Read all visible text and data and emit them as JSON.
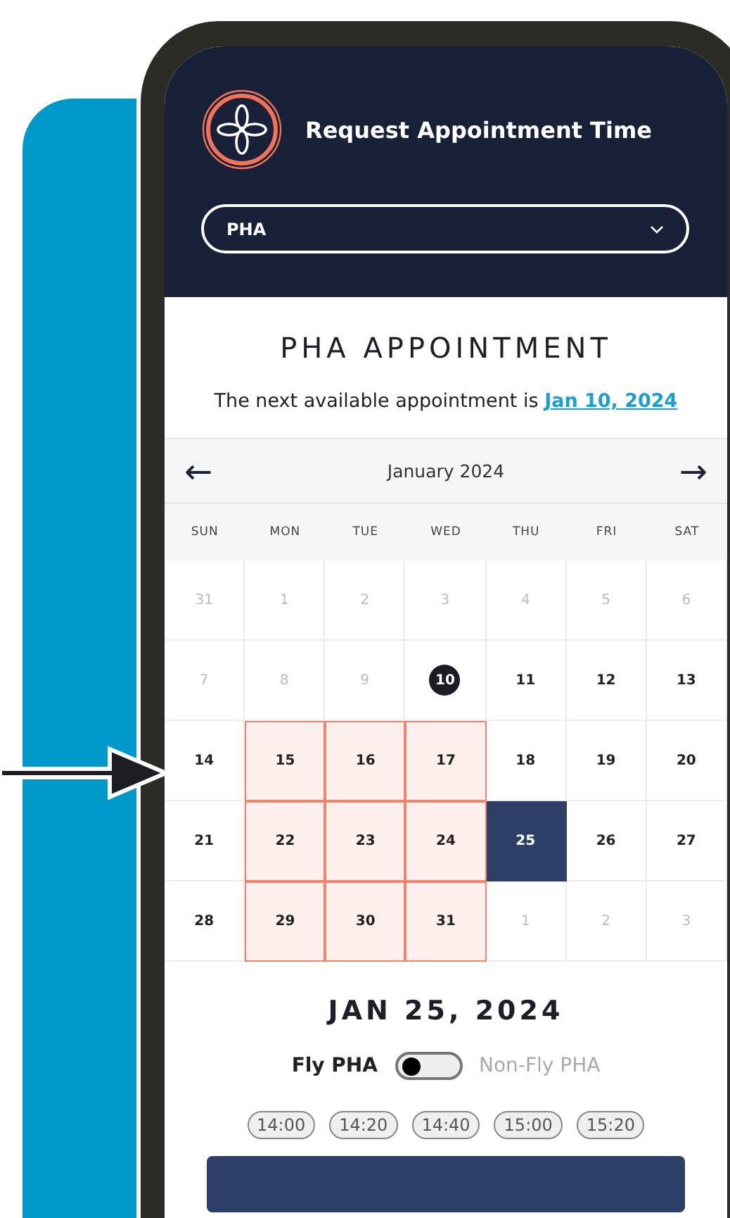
{
  "header": {
    "title": "Request Appointment Time",
    "dropdown": {
      "value": "PHA"
    }
  },
  "heading": "PHA APPOINTMENT",
  "next_available": {
    "text": "The next available appointment is ",
    "link": "Jan 10, 2024"
  },
  "calendar": {
    "month": "January 2024",
    "prev": "←",
    "next": "→",
    "weekdays": [
      "SUN",
      "MON",
      "TUE",
      "WED",
      "THU",
      "FRI",
      "SAT"
    ],
    "days": [
      {
        "label": "31",
        "kind": "other",
        "selected": false
      },
      {
        "label": "1",
        "kind": "other",
        "selected": false
      },
      {
        "label": "2",
        "kind": "other",
        "selected": false
      },
      {
        "label": "3",
        "kind": "other",
        "selected": false
      },
      {
        "label": "4",
        "kind": "other",
        "selected": false
      },
      {
        "label": "5",
        "kind": "other",
        "selected": false
      },
      {
        "label": "6",
        "kind": "other",
        "selected": false
      },
      {
        "label": "7",
        "kind": "other",
        "selected": false
      },
      {
        "label": "8",
        "kind": "other",
        "selected": false
      },
      {
        "label": "9",
        "kind": "other",
        "selected": false
      },
      {
        "label": "10",
        "kind": "today",
        "selected": false
      },
      {
        "label": "11",
        "kind": "normal",
        "selected": false
      },
      {
        "label": "12",
        "kind": "normal",
        "selected": false
      },
      {
        "label": "13",
        "kind": "normal",
        "selected": false
      },
      {
        "label": "14",
        "kind": "normal",
        "selected": false
      },
      {
        "label": "15",
        "kind": "available",
        "selected": false
      },
      {
        "label": "16",
        "kind": "available",
        "selected": false
      },
      {
        "label": "17",
        "kind": "available",
        "selected": false
      },
      {
        "label": "18",
        "kind": "normal",
        "selected": false
      },
      {
        "label": "19",
        "kind": "normal",
        "selected": false
      },
      {
        "label": "20",
        "kind": "normal",
        "selected": false
      },
      {
        "label": "21",
        "kind": "normal",
        "selected": false
      },
      {
        "label": "22",
        "kind": "available",
        "selected": false
      },
      {
        "label": "23",
        "kind": "available",
        "selected": false
      },
      {
        "label": "24",
        "kind": "available",
        "selected": false
      },
      {
        "label": "25",
        "kind": "normal",
        "selected": true
      },
      {
        "label": "26",
        "kind": "normal",
        "selected": false
      },
      {
        "label": "27",
        "kind": "normal",
        "selected": false
      },
      {
        "label": "28",
        "kind": "normal",
        "selected": false
      },
      {
        "label": "29",
        "kind": "available",
        "selected": false
      },
      {
        "label": "30",
        "kind": "available",
        "selected": false
      },
      {
        "label": "31",
        "kind": "available",
        "selected": false
      },
      {
        "label": "1",
        "kind": "other",
        "selected": false
      },
      {
        "label": "2",
        "kind": "other",
        "selected": false
      },
      {
        "label": "3",
        "kind": "other",
        "selected": false
      }
    ]
  },
  "selected_date": "JAN 25, 2024",
  "type_toggle": {
    "left_label": "Fly PHA",
    "right_label": "Non-Fly PHA",
    "on": false
  },
  "time_slots": [
    {
      "label": "14:00",
      "selected": false
    },
    {
      "label": "14:20",
      "selected": false
    },
    {
      "label": "14:40",
      "selected": false
    },
    {
      "label": "15:00",
      "selected": false
    },
    {
      "label": "15:20",
      "selected": false
    }
  ]
}
